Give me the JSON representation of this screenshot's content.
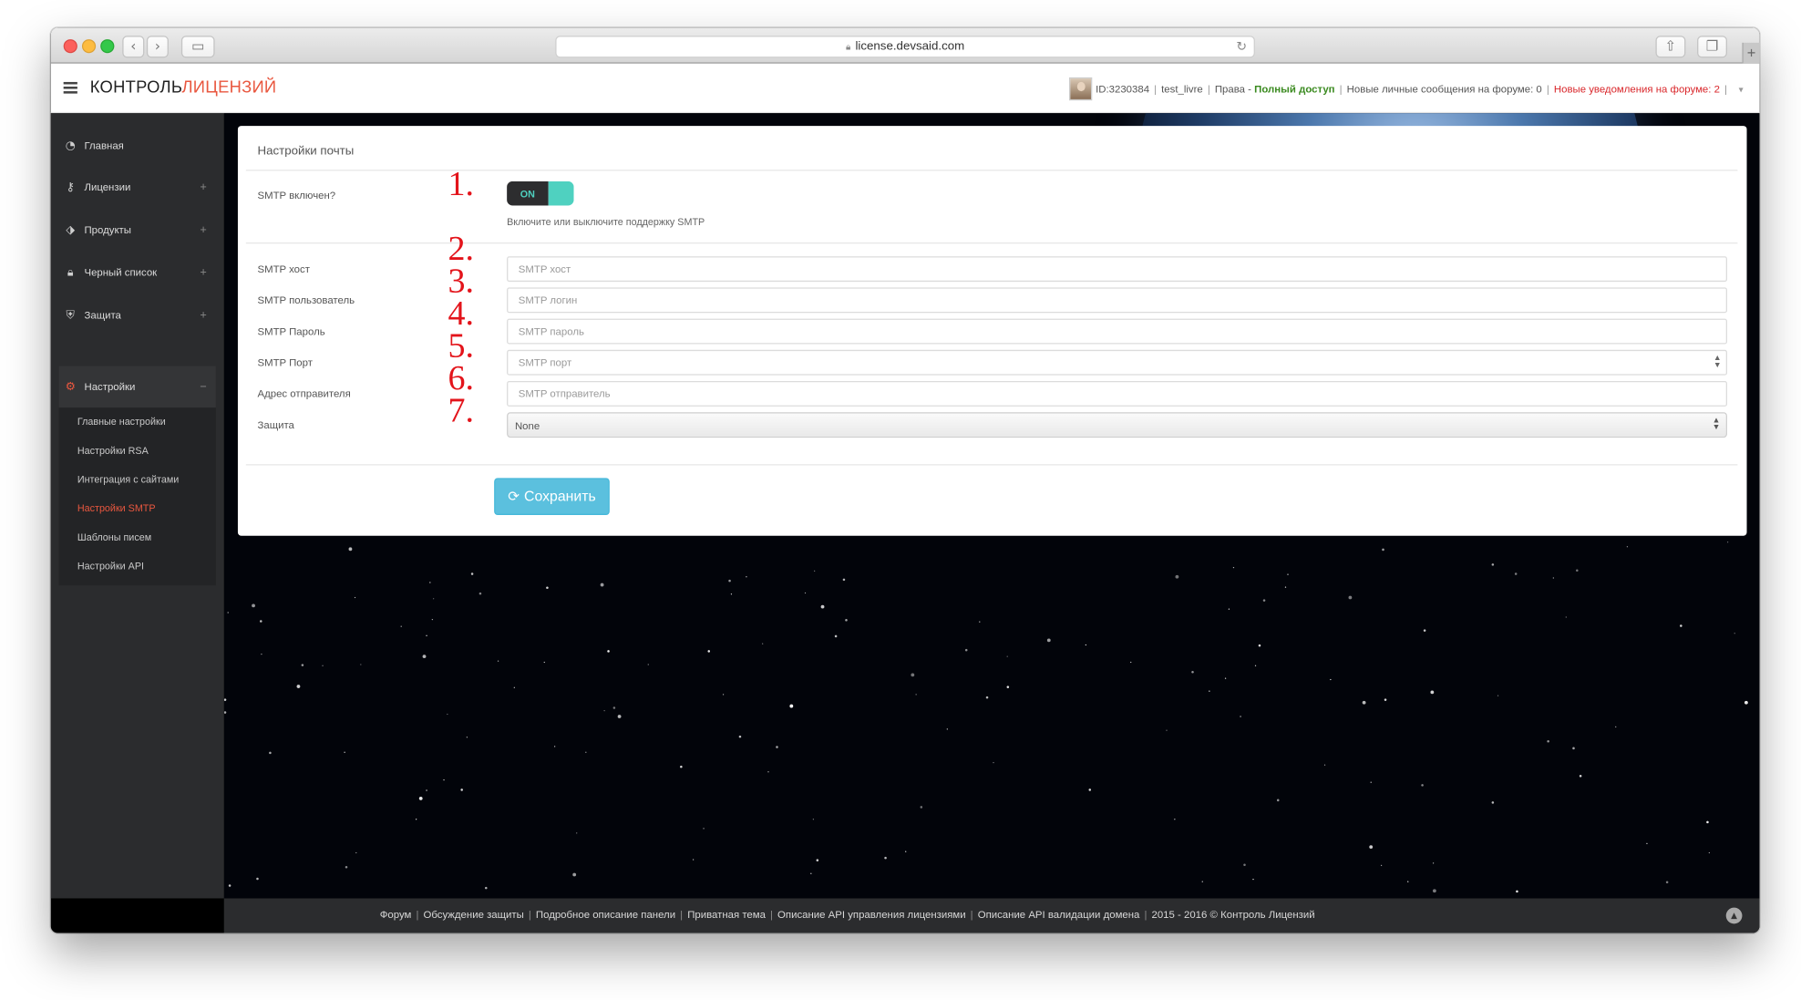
{
  "browser": {
    "url": "license.devsaid.com",
    "back_icon": "chevron-left-icon",
    "forward_icon": "chevron-right-icon"
  },
  "header": {
    "brand_main": "КОНТРОЛЬ",
    "brand_accent": "ЛИЦЕНЗИЙ",
    "user_id": "ID:3230384",
    "username": "test_livre",
    "rights_label": "Права -",
    "rights_value": "Полный доступ",
    "messages": "Новые личные сообщения на форуме: 0",
    "notifications": "Новые уведомления на форуме: 2",
    "separator": "|"
  },
  "sidebar": {
    "items": [
      {
        "label": "Главная",
        "icon": "dashboard-icon"
      },
      {
        "label": "Лицензии",
        "icon": "key-icon",
        "toggle": "+"
      },
      {
        "label": "Продукты",
        "icon": "tags-icon",
        "toggle": "+"
      },
      {
        "label": "Черный список",
        "icon": "lock-icon",
        "toggle": "+"
      },
      {
        "label": "Защита",
        "icon": "shield-icon",
        "toggle": "+"
      },
      {
        "label": "Настройки",
        "icon": "gears-icon",
        "toggle": "−"
      }
    ],
    "subitems": [
      {
        "label": "Главные настройки"
      },
      {
        "label": "Настройки RSA"
      },
      {
        "label": "Интеграция с сайтами"
      },
      {
        "label": "Настройки SMTP"
      },
      {
        "label": "Шаблоны писем"
      },
      {
        "label": "Настройки API"
      }
    ],
    "active_color": "#e9573f"
  },
  "panel": {
    "title": "Настройки почты",
    "smtp_enabled_label": "SMTP включен?",
    "toggle_state": "ON",
    "toggle_help": "Включите или выключите поддержку SMTP",
    "fields": [
      {
        "label": "SMTP хост",
        "placeholder": "SMTP хост",
        "number": "2."
      },
      {
        "label": "SMTP пользователь",
        "placeholder": "SMTP логин",
        "number": "3."
      },
      {
        "label": "SMTP Пароль",
        "placeholder": "SMTP пароль",
        "number": "4."
      },
      {
        "label": "SMTP Порт",
        "placeholder": "SMTP порт",
        "number": "5."
      },
      {
        "label": "Адрес отправителя",
        "placeholder": "SMTP отправитель",
        "number": "6."
      }
    ],
    "security_label": "Защита",
    "security_value": "None",
    "security_number": "7.",
    "toggle_number": "1.",
    "save_label": "Сохранить",
    "save_icon": "refresh-icon"
  },
  "footer": {
    "links": [
      "Форум",
      "Обсуждение защиты",
      "Подробное описание панели",
      "Приватная тема",
      "Описание API управления лицензиями",
      "Описание API валидации домена",
      "2015 - 2016 © Контроль Лицензий"
    ]
  },
  "colors": {
    "accent_red": "#e9573f",
    "toggle_teal": "#4fd1c0",
    "save_button": "#5bc0de",
    "sidebar_bg": "#2b2c2e",
    "annotation_red": "#e3141b"
  }
}
